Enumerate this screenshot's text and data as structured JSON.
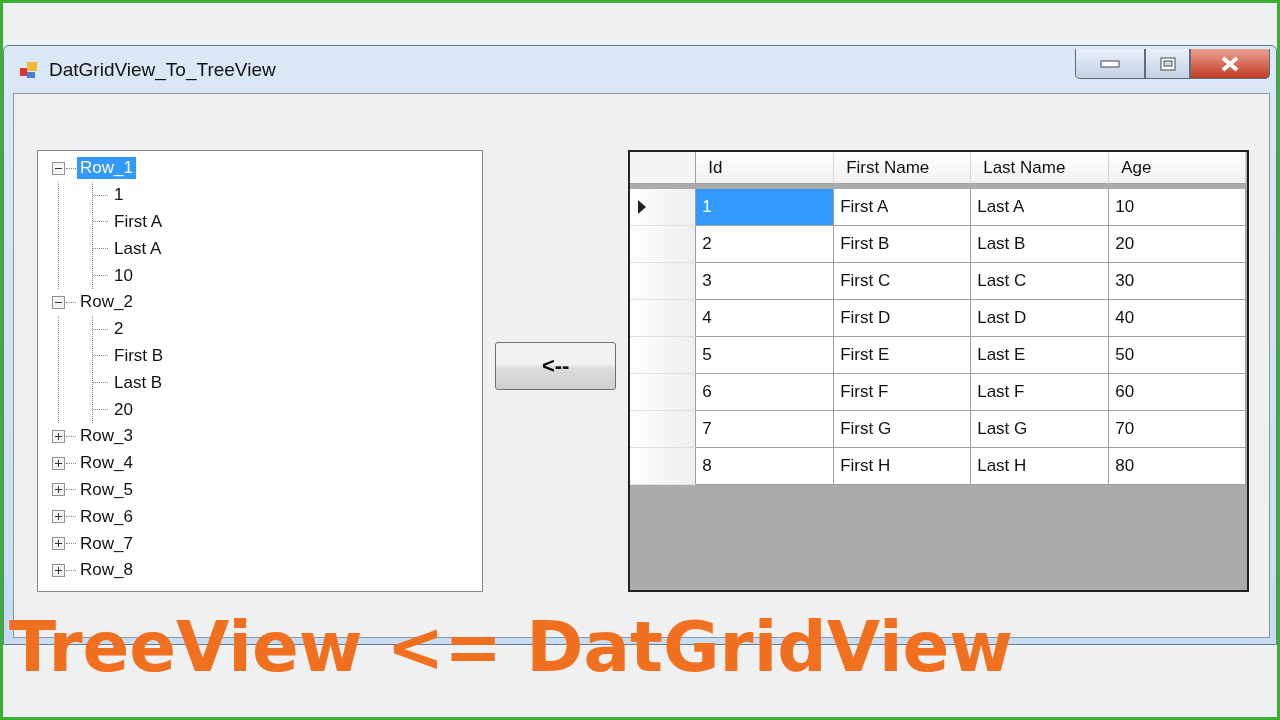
{
  "window": {
    "title": "DatGridView_To_TreeView"
  },
  "tree": [
    {
      "label": "Row_1",
      "selected": true,
      "expanded": true,
      "children": [
        {
          "label": "1"
        },
        {
          "label": "First A"
        },
        {
          "label": "Last A"
        },
        {
          "label": "10"
        }
      ]
    },
    {
      "label": "Row_2",
      "selected": false,
      "expanded": true,
      "children": [
        {
          "label": "2"
        },
        {
          "label": "First B"
        },
        {
          "label": "Last B"
        },
        {
          "label": "20"
        }
      ]
    },
    {
      "label": "Row_3",
      "selected": false,
      "expanded": false
    },
    {
      "label": "Row_4",
      "selected": false,
      "expanded": false
    },
    {
      "label": "Row_5",
      "selected": false,
      "expanded": false
    },
    {
      "label": "Row_6",
      "selected": false,
      "expanded": false
    },
    {
      "label": "Row_7",
      "selected": false,
      "expanded": false
    },
    {
      "label": "Row_8",
      "selected": false,
      "expanded": false
    }
  ],
  "transfer_button": "<--",
  "grid": {
    "columns": [
      "Id",
      "First Name",
      "Last Name",
      "Age"
    ],
    "rows": [
      {
        "current": true,
        "cells": [
          {
            "text": "1",
            "selected": true
          },
          {
            "text": "First A",
            "selected": false
          },
          {
            "text": "Last A",
            "selected": false
          },
          {
            "text": "10",
            "selected": false
          }
        ]
      },
      {
        "current": false,
        "cells": [
          {
            "text": "2",
            "selected": false
          },
          {
            "text": "First B",
            "selected": false
          },
          {
            "text": "Last B",
            "selected": false
          },
          {
            "text": "20",
            "selected": false
          }
        ]
      },
      {
        "current": false,
        "cells": [
          {
            "text": "3",
            "selected": false
          },
          {
            "text": "First C",
            "selected": false
          },
          {
            "text": "Last C",
            "selected": false
          },
          {
            "text": "30",
            "selected": false
          }
        ]
      },
      {
        "current": false,
        "cells": [
          {
            "text": "4",
            "selected": false
          },
          {
            "text": "First D",
            "selected": false
          },
          {
            "text": "Last D",
            "selected": false
          },
          {
            "text": "40",
            "selected": false
          }
        ]
      },
      {
        "current": false,
        "cells": [
          {
            "text": "5",
            "selected": false
          },
          {
            "text": "First E",
            "selected": false
          },
          {
            "text": "Last E",
            "selected": false
          },
          {
            "text": "50",
            "selected": false
          }
        ]
      },
      {
        "current": false,
        "cells": [
          {
            "text": "6",
            "selected": false
          },
          {
            "text": "First F",
            "selected": false
          },
          {
            "text": "Last F",
            "selected": false
          },
          {
            "text": "60",
            "selected": false
          }
        ]
      },
      {
        "current": false,
        "cells": [
          {
            "text": "7",
            "selected": false
          },
          {
            "text": "First G",
            "selected": false
          },
          {
            "text": "Last G",
            "selected": false
          },
          {
            "text": "70",
            "selected": false
          }
        ]
      },
      {
        "current": false,
        "cells": [
          {
            "text": "8",
            "selected": false
          },
          {
            "text": "First H",
            "selected": false
          },
          {
            "text": "Last H",
            "selected": false
          },
          {
            "text": "80",
            "selected": false
          }
        ]
      }
    ]
  },
  "caption": "TreeView <= DatGridView"
}
